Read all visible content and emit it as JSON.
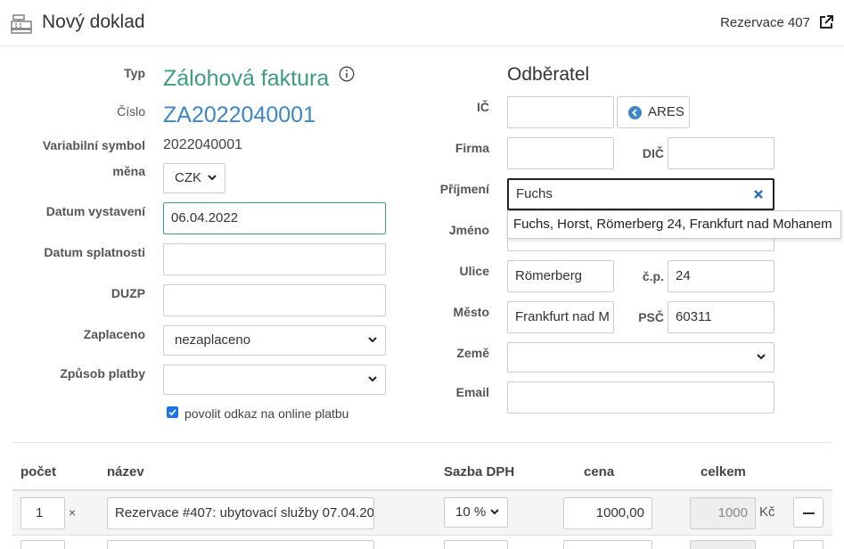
{
  "header": {
    "title": "Nový doklad",
    "link": "Rezervace 407"
  },
  "left": {
    "typ_label": "Typ",
    "typ_value": "Zálohová faktura",
    "cislo_label": "Číslo",
    "cislo_value": "ZA2022040001",
    "vs_label": "Variabilní symbol",
    "vs_value": "2022040001",
    "mena_label": "měna",
    "mena_value": "CZK",
    "datum_vystaveni_label": "Datum vystavení",
    "datum_vystaveni_value": "06.04.2022",
    "datum_splatnosti_label": "Datum splatnosti",
    "duzp_label": "DUZP",
    "zaplaceno_label": "Zaplaceno",
    "zaplaceno_value": "nezaplaceno",
    "zpusob_label": "Způsob platby",
    "online_label": "povolit odkaz na online platbu"
  },
  "right": {
    "title": "Odběratel",
    "ic_label": "IČ",
    "ares_label": "ARES",
    "firma_label": "Firma",
    "dic_label": "DIČ",
    "prijmeni_label": "Příjmení",
    "prijmeni_value": "Fuchs",
    "suggestion": "Fuchs, Horst, Römerberg 24, Frankfurt nad Mohanem",
    "jmeno_label": "Jméno",
    "ulice_label": "Ulice",
    "ulice_value": "Römerberg",
    "cp_label": "č.p.",
    "cp_value": "24",
    "mesto_label": "Město",
    "mesto_value": "Frankfurt nad M",
    "psc_label": "PSČ",
    "psc_value": "60311",
    "zeme_label": "Země",
    "email_label": "Email"
  },
  "table": {
    "headers": [
      "počet",
      "název",
      "Sazba DPH",
      "cena",
      "celkem"
    ],
    "rows": [
      {
        "qty": "1",
        "times": "×",
        "name": "Rezervace #407: ubytovací služby 07.04.20",
        "vat": "10 %",
        "price": "1000,00",
        "total": "1000",
        "currency": "Kč"
      }
    ]
  },
  "colors": {
    "accent_green": "#3c9d7e",
    "accent_blue": "#3d87c8"
  }
}
